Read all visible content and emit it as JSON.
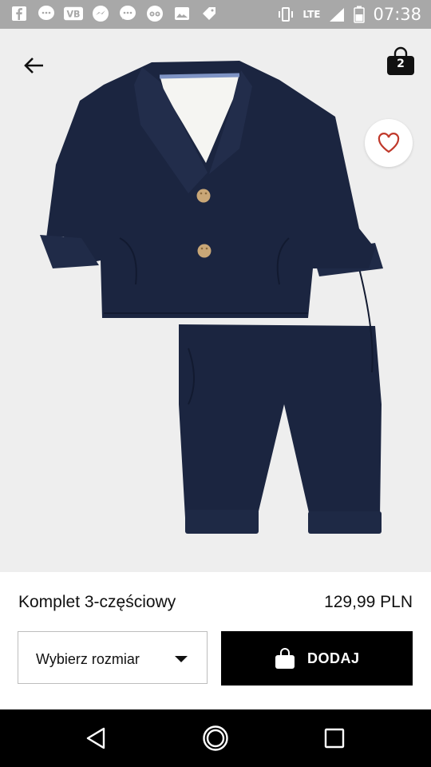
{
  "status_bar": {
    "time": "07:38",
    "network": "LTE",
    "icons": [
      "facebook-icon",
      "messenger-icon",
      "vb-icon",
      "messenger-icon",
      "chat-icon",
      "tripadvisor-icon",
      "image-icon",
      "tag-icon"
    ]
  },
  "header": {
    "cart_count": "2"
  },
  "product": {
    "name": "Komplet 3-częściowy",
    "price": "129,99 PLN",
    "size_select_label": "Wybierz rozmiar",
    "add_button_label": "DODAJ",
    "item_color": "#1c2640"
  },
  "colors": {
    "accent": "#000000",
    "favorite": "#c0392b"
  }
}
